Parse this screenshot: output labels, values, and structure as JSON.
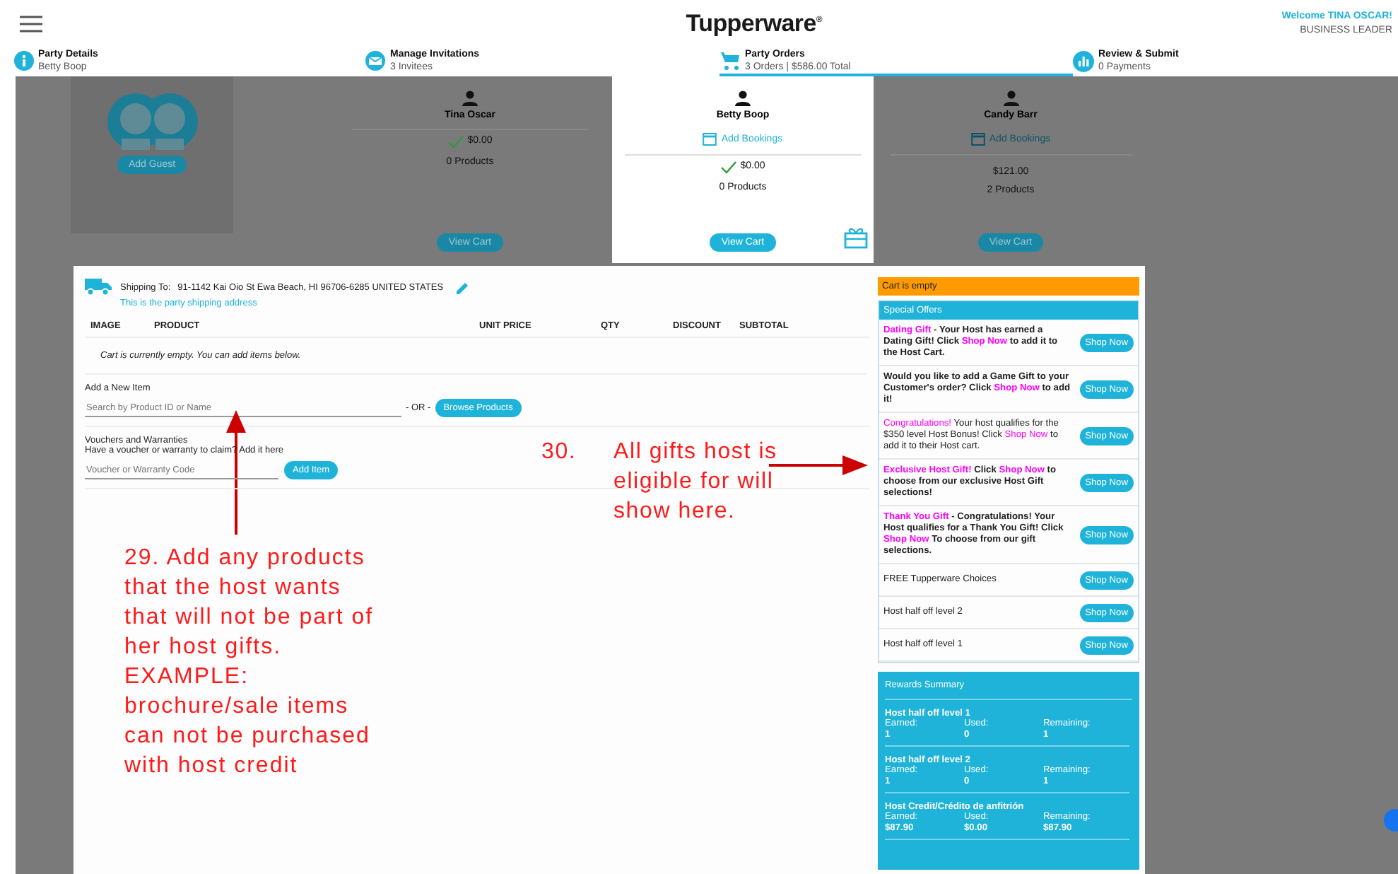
{
  "header": {
    "logo": "Tupperware$^{®}$",
    "welcome": "Welcome TINA OSCAR!",
    "role": "BUSINESS LEADER"
  },
  "steps": [
    {
      "kind": "info",
      "title": "Party Details",
      "subtitle": "Betty Boop",
      "selected": false
    },
    {
      "kind": "mail",
      "title": "Manage Invitations",
      "subtitle": "3 Invitees",
      "selected": false
    },
    {
      "kind": "cart",
      "title": "Party Orders",
      "subtitle": "3 Orders | $586.00 Total",
      "selected": true
    },
    {
      "kind": "chart",
      "title": "Review & Submit",
      "subtitle": "0 Payments",
      "selected": false
    }
  ],
  "guests": [
    {
      "kind": "add",
      "button": "Add Guest"
    },
    {
      "kind": "guest",
      "name": "Tina Oscar",
      "amount": "$0.00",
      "paid": true,
      "products": "0 Products",
      "button": "View Cart",
      "selected": false,
      "gift": false
    },
    {
      "kind": "guest",
      "name": "Betty Boop",
      "bookings": "Add Bookings",
      "amount": "$0.00",
      "paid": true,
      "products": "0 Products",
      "button": "View Cart",
      "selected": true,
      "gift": true
    },
    {
      "kind": "guest",
      "name": "Candy Barr",
      "bookings": "Add Bookings",
      "amount": "$121.00",
      "paid": false,
      "products": "2 Products",
      "button": "View Cart",
      "selected": false,
      "gift": false
    }
  ],
  "shipping": {
    "label": "Shipping To:",
    "address": "91-1142 Kai Oio St Ewa Beach, HI 96706-6285 UNITED STATES",
    "note": "This is the party shipping address"
  },
  "table": {
    "columns": [
      "IMAGE",
      "PRODUCT",
      "UNIT PRICE",
      "QTY",
      "DISCOUNT",
      "SUBTOTAL"
    ],
    "empty_message": "Cart is currently empty. You can add items below."
  },
  "add_item": {
    "label": "Add a New Item",
    "placeholder": "Search by Product ID or Name",
    "or": "- OR -",
    "button": "Browse Products"
  },
  "vouchers": {
    "title": "Vouchers and Warranties",
    "prompt": "Have a voucher or warranty to claim? Add it here",
    "placeholder": "Voucher or Warranty Code",
    "button": "Add Item"
  },
  "sidebar": {
    "cart_status": "Cart is empty",
    "offers_title": "Special Offers",
    "offers": [
      {
        "bold": true,
        "parts": [
          {
            "text": "Dating Gift",
            "highlight": true
          },
          {
            "text": " - Your Host has earned a Dating Gift!  Click ",
            "highlight": false
          },
          {
            "text": "Shop Now",
            "highlight": true
          },
          {
            "text": " to add it to the Host Cart.",
            "highlight": false
          }
        ],
        "button": "Shop Now"
      },
      {
        "bold": true,
        "parts": [
          {
            "text": "Would you like to add a Game Gift to your Customer's order?  Click ",
            "highlight": false
          },
          {
            "text": "Shop Now",
            "highlight": true
          },
          {
            "text": " to add it!",
            "highlight": false
          }
        ],
        "button": "Shop Now"
      },
      {
        "bold": false,
        "parts": [
          {
            "text": "Congratulations!",
            "highlight": true
          },
          {
            "text": "  Your host qualifies for the $350 level Host Bonus!  Click ",
            "highlight": false
          },
          {
            "text": "Shop Now",
            "highlight": true
          },
          {
            "text": " to add it to their Host cart.",
            "highlight": false
          }
        ],
        "button": "Shop Now"
      },
      {
        "bold": true,
        "parts": [
          {
            "text": "Exclusive Host Gift!",
            "highlight": true
          },
          {
            "text": "  Click ",
            "highlight": false
          },
          {
            "text": "Shop Now",
            "highlight": true
          },
          {
            "text": " to choose from our exclusive Host Gift selections!",
            "highlight": false
          }
        ],
        "button": "Shop Now"
      },
      {
        "bold": true,
        "parts": [
          {
            "text": "Thank You Gift",
            "highlight": true
          },
          {
            "text": " - Congratulations!  Your Host qualifies for a Thank You Gift!  Click  ",
            "highlight": false
          },
          {
            "text": "Shop Now",
            "highlight": true
          },
          {
            "text": "  To choose from our gift selections.",
            "highlight": false
          }
        ],
        "button": "Shop Now"
      },
      {
        "bold": false,
        "parts": [
          {
            "text": "FREE Tupperware Choices",
            "highlight": false
          }
        ],
        "button": "Shop Now"
      },
      {
        "bold": false,
        "parts": [
          {
            "text": "Host half off level 2",
            "highlight": false
          }
        ],
        "button": "Shop Now"
      },
      {
        "bold": false,
        "parts": [
          {
            "text": "Host half off level 1",
            "highlight": false
          }
        ],
        "button": "Shop Now"
      }
    ],
    "rewards_title": "Rewards Summary",
    "rewards": [
      {
        "name": "Host half off level 1",
        "cells": [
          {
            "label": "Earned:",
            "value": "1"
          },
          {
            "label": "Used:",
            "value": "0"
          },
          {
            "label": "Remaining:",
            "value": "1"
          }
        ]
      },
      {
        "name": "Host half off level 2",
        "cells": [
          {
            "label": "Earned:",
            "value": "1"
          },
          {
            "label": "Used:",
            "value": "0"
          },
          {
            "label": "Remaining:",
            "value": "1"
          }
        ]
      },
      {
        "name": "Host Credit/Crédito de anfitrión",
        "cells": [
          {
            "label": "Earned:",
            "value": "$87.90"
          },
          {
            "label": "Used:",
            "value": "$0.00"
          },
          {
            "label": "Remaining:",
            "value": "$87.90"
          }
        ]
      }
    ]
  },
  "annotations": [
    {
      "number": "30.",
      "text": "All gifts host is eligible for will show here."
    },
    {
      "text": "29.  Add any products that the host wants that will not be part of her host gifts.  EXAMPLE: brochure/sale items can not be purchased with host credit"
    }
  ]
}
